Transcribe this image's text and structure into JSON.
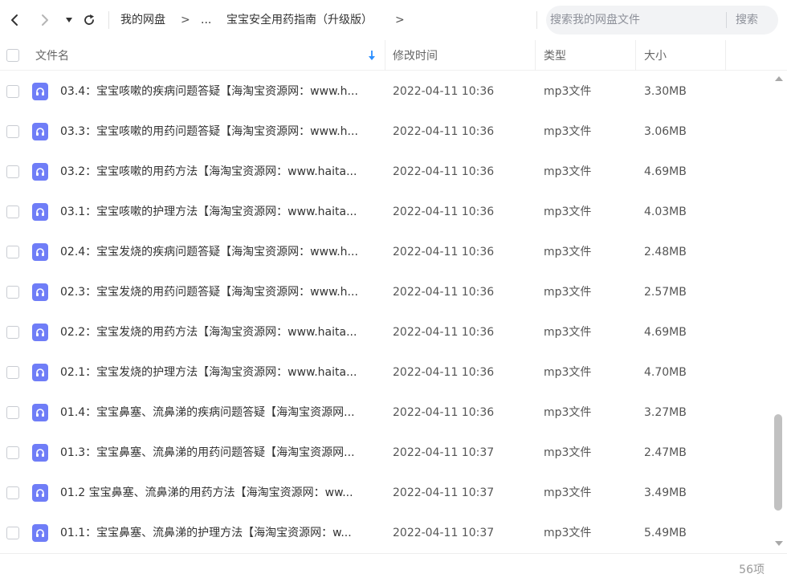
{
  "toolbar": {
    "back_icon": "chevron-left-icon",
    "forward_icon": "chevron-right-icon",
    "dropdown_icon": "caret-down-icon",
    "refresh_icon": "refresh-icon",
    "breadcrumb": {
      "root": "我的网盘",
      "sep1": ">",
      "ellipsis": "...",
      "current": "宝宝安全用药指南（升级版）",
      "sep2": ">"
    },
    "search": {
      "placeholder": "搜索我的网盘文件",
      "button": "搜索"
    }
  },
  "table": {
    "headers": {
      "name": "文件名",
      "sort_icon": "sort-arrow-down-icon",
      "time": "修改时间",
      "type": "类型",
      "size": "大小"
    },
    "rows": [
      {
        "name": "03.4：宝宝咳嗽的疾病问题答疑【海淘宝资源网：www.h...",
        "time": "2022-04-11 10:36",
        "type": "mp3文件",
        "size": "3.30MB"
      },
      {
        "name": "03.3：宝宝咳嗽的用药问题答疑【海淘宝资源网：www.h...",
        "time": "2022-04-11 10:36",
        "type": "mp3文件",
        "size": "3.06MB"
      },
      {
        "name": "03.2：宝宝咳嗽的用药方法【海淘宝资源网：www.haita...",
        "time": "2022-04-11 10:36",
        "type": "mp3文件",
        "size": "4.69MB"
      },
      {
        "name": "03.1：宝宝咳嗽的护理方法【海淘宝资源网：www.haita...",
        "time": "2022-04-11 10:36",
        "type": "mp3文件",
        "size": "4.03MB"
      },
      {
        "name": "02.4：宝宝发烧的疾病问题答疑【海淘宝资源网：www.h...",
        "time": "2022-04-11 10:36",
        "type": "mp3文件",
        "size": "2.48MB"
      },
      {
        "name": "02.3：宝宝发烧的用药问题答疑【海淘宝资源网：www.h...",
        "time": "2022-04-11 10:36",
        "type": "mp3文件",
        "size": "2.57MB"
      },
      {
        "name": "02.2：宝宝发烧的用药方法【海淘宝资源网：www.haita...",
        "time": "2022-04-11 10:36",
        "type": "mp3文件",
        "size": "4.69MB"
      },
      {
        "name": "02.1：宝宝发烧的护理方法【海淘宝资源网：www.haita...",
        "time": "2022-04-11 10:36",
        "type": "mp3文件",
        "size": "4.70MB"
      },
      {
        "name": "01.4：宝宝鼻塞、流鼻涕的疾病问题答疑【海淘宝资源网...",
        "time": "2022-04-11 10:36",
        "type": "mp3文件",
        "size": "3.27MB"
      },
      {
        "name": "01.3：宝宝鼻塞、流鼻涕的用药问题答疑【海淘宝资源网...",
        "time": "2022-04-11 10:37",
        "type": "mp3文件",
        "size": "2.47MB"
      },
      {
        "name": "01.2 宝宝鼻塞、流鼻涕的用药方法【海淘宝资源网：ww...",
        "time": "2022-04-11 10:37",
        "type": "mp3文件",
        "size": "3.49MB"
      },
      {
        "name": "01.1：宝宝鼻塞、流鼻涕的护理方法【海淘宝资源网：w...",
        "time": "2022-04-11 10:37",
        "type": "mp3文件",
        "size": "5.49MB"
      }
    ]
  },
  "file_icon": "audio-file-icon",
  "scroll_position": 0.93,
  "footer": {
    "count": "56项"
  },
  "colors": {
    "accent": "#2b8fff",
    "file_icon_bg": "#6f7df7",
    "search_bg": "#f2f3f5"
  }
}
